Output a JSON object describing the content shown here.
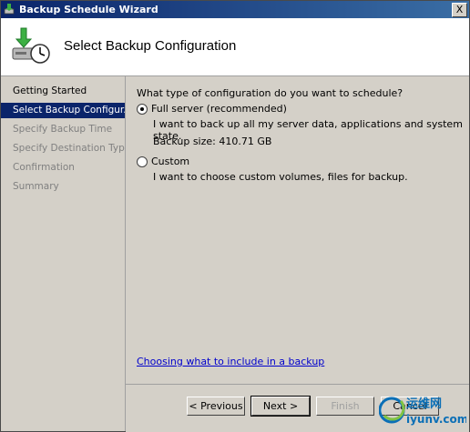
{
  "window": {
    "title": "Backup Schedule Wizard",
    "close_glyph": "X"
  },
  "header": {
    "page_title": "Select Backup Configuration"
  },
  "nav": {
    "items": [
      {
        "label": "Getting Started",
        "state": "done"
      },
      {
        "label": "Select Backup Configur...",
        "state": "active"
      },
      {
        "label": "Specify Backup Time",
        "state": "pending"
      },
      {
        "label": "Specify Destination Type",
        "state": "pending"
      },
      {
        "label": "Confirmation",
        "state": "pending"
      },
      {
        "label": "Summary",
        "state": "pending"
      }
    ]
  },
  "content": {
    "question": "What type of configuration do you want to schedule?",
    "options": [
      {
        "label": "Full server (recommended)",
        "selected": true,
        "description": "I want to back up all my server data, applications and system state.",
        "backup_size": "Backup size: 410.71 GB"
      },
      {
        "label": "Custom",
        "selected": false,
        "description": "I want to choose custom volumes, files for backup."
      }
    ],
    "help_link": "Choosing what to include in a backup"
  },
  "footer": {
    "previous_label": "< Previous",
    "next_label": "Next >",
    "finish_label": "Finish",
    "cancel_label": "Cancel"
  },
  "watermark": {
    "text": "运维网",
    "domain": "iyunv.com"
  },
  "colors": {
    "titlebar": "#0a246a",
    "selection": "#0a246a",
    "link": "#0000cc"
  }
}
